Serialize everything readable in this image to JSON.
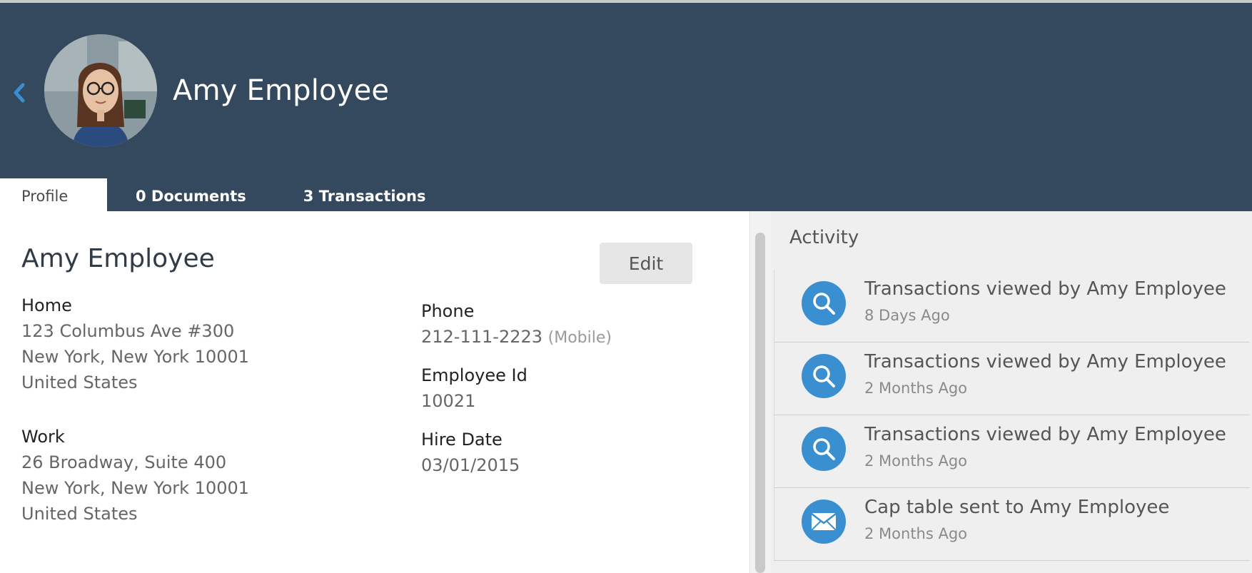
{
  "header": {
    "name": "Amy Employee"
  },
  "tabs": [
    {
      "label": "Profile"
    },
    {
      "label": "0 Documents"
    },
    {
      "label": "3 Transactions"
    }
  ],
  "profile": {
    "title": "Amy Employee",
    "edit_label": "Edit",
    "home": {
      "label": "Home",
      "line1": "123 Columbus Ave #300",
      "line2": "New York, New York 10001",
      "line3": "United States"
    },
    "work": {
      "label": "Work",
      "line1": "26 Broadway, Suite 400",
      "line2": "New York, New York 10001",
      "line3": "United States"
    },
    "phone": {
      "label": "Phone",
      "value": "212-111-2223",
      "type": "(Mobile)"
    },
    "employee_id": {
      "label": "Employee Id",
      "value": "10021"
    },
    "hire_date": {
      "label": "Hire Date",
      "value": "03/01/2015"
    }
  },
  "activity": {
    "title": "Activity",
    "items": [
      {
        "text": "Transactions viewed by Amy Employee",
        "time": "8 Days Ago",
        "icon": "search-icon"
      },
      {
        "text": "Transactions viewed by Amy Employee",
        "time": "2 Months Ago",
        "icon": "search-icon"
      },
      {
        "text": "Transactions viewed by Amy Employee",
        "time": "2 Months Ago",
        "icon": "search-icon"
      },
      {
        "text": "Cap table sent to Amy Employee",
        "time": "2 Months Ago",
        "icon": "envelope-icon"
      }
    ]
  },
  "colors": {
    "header_bg": "#34495e",
    "accent": "#3a8fd1",
    "activity_bg": "#efefef"
  }
}
